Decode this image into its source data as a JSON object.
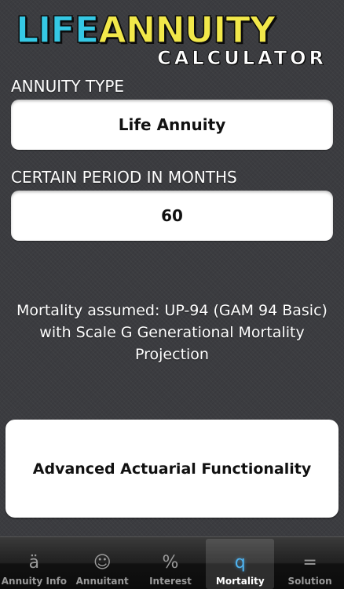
{
  "logo": {
    "word1": "LIFE",
    "word2": "ANNUITY",
    "subtitle": "CALCULATOR"
  },
  "annuity_type": {
    "label": "ANNUITY TYPE",
    "value": "Life Annuity"
  },
  "certain_period": {
    "label": "CERTAIN PERIOD IN MONTHS",
    "value": "60"
  },
  "mortality_note": {
    "line1": "Mortality assumed: UP-94 (GAM 94 Basic)",
    "line2": "with Scale G Generational Mortality",
    "line3": "Projection"
  },
  "advanced_button": {
    "label": "Advanced Actuarial Functionality"
  },
  "tabs": [
    {
      "label": "Annuity Info",
      "icon": "a-umlaut-icon",
      "glyph": "ä",
      "active": false
    },
    {
      "label": "Annuitant",
      "icon": "smiley-icon",
      "glyph": "☺",
      "active": false
    },
    {
      "label": "Interest",
      "icon": "percent-icon",
      "glyph": "%",
      "active": false
    },
    {
      "label": "Mortality",
      "icon": "q-letter-icon",
      "glyph": "q",
      "active": true
    },
    {
      "label": "Solution",
      "icon": "equals-icon",
      "glyph": "=",
      "active": false
    }
  ],
  "colors": {
    "logo_life": "#35c8e4",
    "logo_annuity": "#f2e84a",
    "active_tab_icon": "#4fb3f0",
    "background": "#3b3c40"
  }
}
